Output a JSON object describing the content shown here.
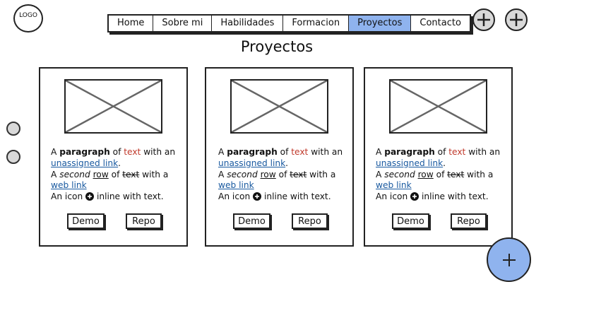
{
  "logo": {
    "label": "LOGO"
  },
  "nav": {
    "items": [
      {
        "label": "Home"
      },
      {
        "label": "Sobre mi"
      },
      {
        "label": "Habilidades"
      },
      {
        "label": "Formacion"
      },
      {
        "label": "Proyectos"
      },
      {
        "label": "Contacto"
      }
    ],
    "active": "Proyectos"
  },
  "page_title": "Proyectos",
  "cards": [
    {
      "p1": {
        "a": "A ",
        "bold": "paragraph",
        "b": " of ",
        "red": "text",
        "c": " with an"
      },
      "link1": "unassigned link",
      "dot": ".",
      "p2": {
        "a": "A ",
        "italic": "second",
        "b": " ",
        "underline": "row",
        "c": " of ",
        "strike": "text",
        "d": " with a"
      },
      "link2": "web link",
      "p3": {
        "a": "An icon ",
        "b": " inline with text."
      },
      "demo_label": "Demo",
      "repo_label": "Repo"
    },
    {
      "p1": {
        "a": "A ",
        "bold": "paragraph",
        "b": " of ",
        "red": "text",
        "c": " with an"
      },
      "link1": "unassigned link",
      "dot": ".",
      "p2": {
        "a": "A ",
        "italic": "second",
        "b": " ",
        "underline": "row",
        "c": " of ",
        "strike": "text",
        "d": " with a"
      },
      "link2": "web link",
      "p3": {
        "a": "An icon ",
        "b": " inline with text."
      },
      "demo_label": "Demo",
      "repo_label": "Repo"
    },
    {
      "p1": {
        "a": "A ",
        "bold": "paragraph",
        "b": " of ",
        "red": "text",
        "c": " with an"
      },
      "link1": "unassigned link",
      "dot": ".",
      "p2": {
        "a": "A ",
        "italic": "second",
        "b": " ",
        "underline": "row",
        "c": " of ",
        "strike": "text",
        "d": " with a"
      },
      "link2": "web link",
      "p3": {
        "a": "An icon ",
        "b": " inline with text."
      },
      "demo_label": "Demo",
      "repo_label": "Repo"
    }
  ],
  "icons": {
    "top_add_1": "plus-circle-icon",
    "top_add_2": "plus-circle-icon",
    "inline": "plus-circle-filled-icon",
    "fab": "plus-icon",
    "image_placeholder": "image-placeholder-icon"
  },
  "colors": {
    "accent": "#8fb3ee",
    "link": "#1a5aa0",
    "red_text": "#c0392b",
    "button_gray": "#d9d9d9"
  }
}
